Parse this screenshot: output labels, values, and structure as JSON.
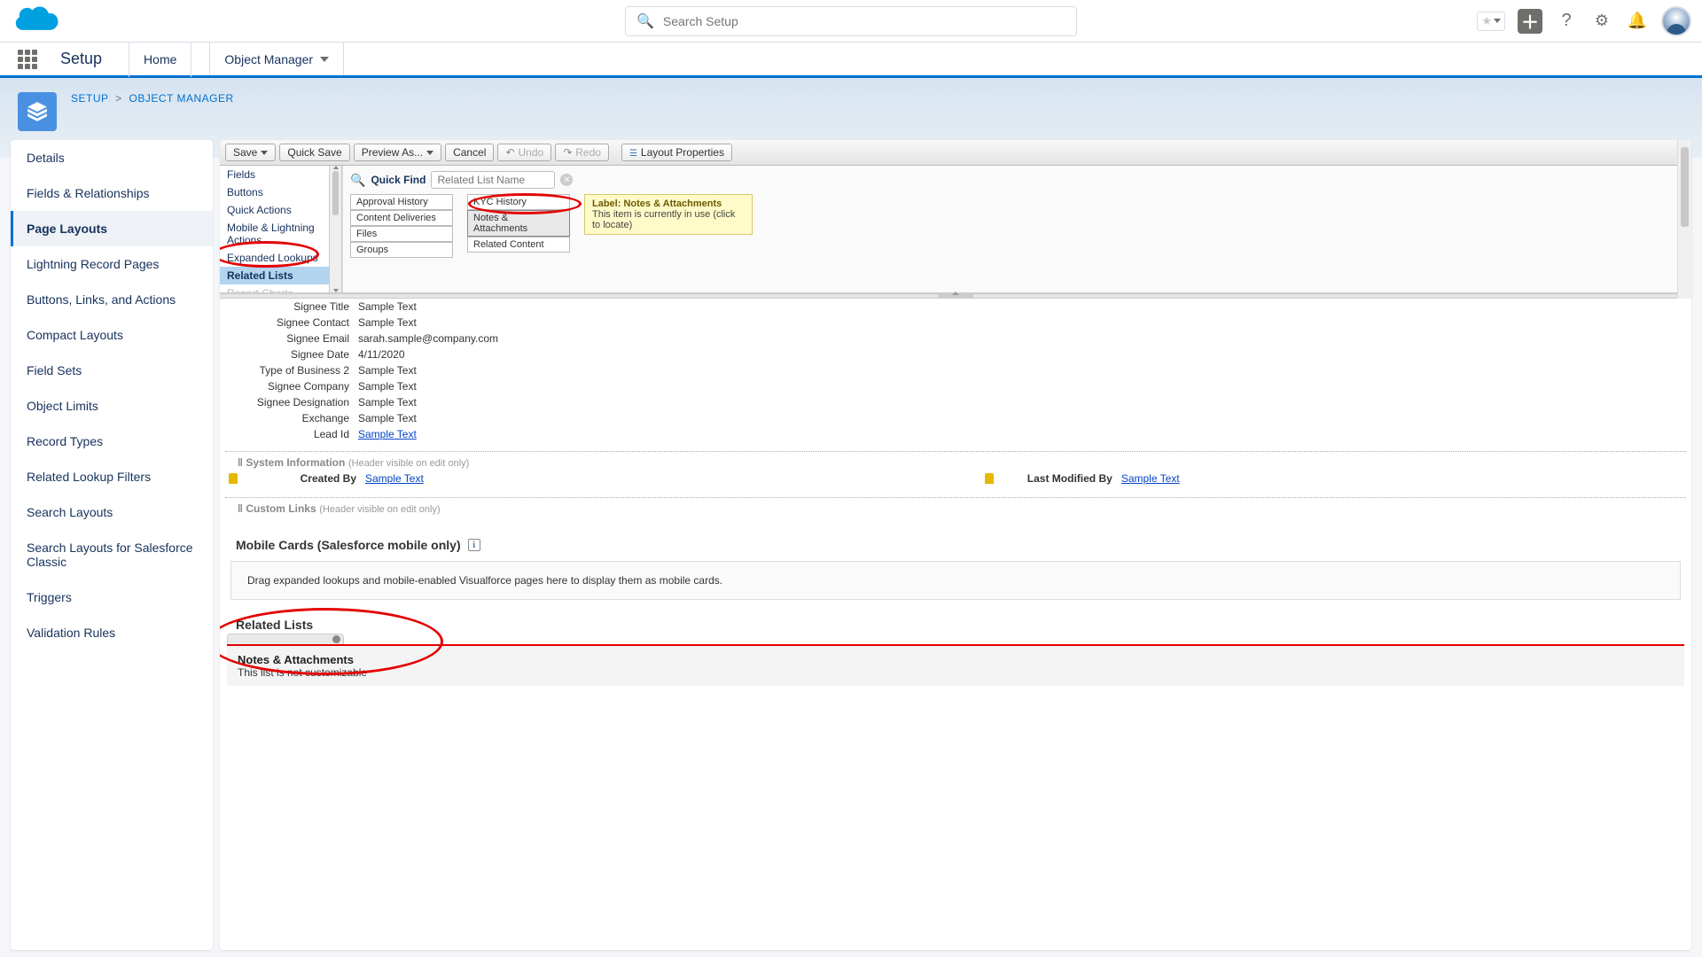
{
  "header": {
    "search_placeholder": "Search Setup"
  },
  "nav": {
    "app_name": "Setup",
    "tabs": {
      "home": "Home",
      "object_manager": "Object Manager"
    }
  },
  "breadcrumb": {
    "setup": "SETUP",
    "object_manager": "OBJECT MANAGER"
  },
  "sidebar": {
    "items": [
      "Details",
      "Fields & Relationships",
      "Page Layouts",
      "Lightning Record Pages",
      "Buttons, Links, and Actions",
      "Compact Layouts",
      "Field Sets",
      "Object Limits",
      "Record Types",
      "Related Lookup Filters",
      "Search Layouts",
      "Search Layouts for Salesforce Classic",
      "Triggers",
      "Validation Rules"
    ],
    "active_index": 2
  },
  "toolbar": {
    "save": "Save",
    "quick_save": "Quick Save",
    "preview_as": "Preview As...",
    "cancel": "Cancel",
    "undo": "Undo",
    "redo": "Redo",
    "layout_props": "Layout Properties"
  },
  "palette": {
    "categories": [
      "Fields",
      "Buttons",
      "Quick Actions",
      "Mobile & Lightning Actions",
      "Expanded Lookups",
      "Related Lists",
      "Report Charts"
    ],
    "selected_index": 5,
    "quick_find_label": "Quick Find",
    "quick_find_placeholder": "Related List Name",
    "col1": [
      "Approval History",
      "Content Deliveries",
      "Files",
      "Groups"
    ],
    "col2": [
      "KYC History",
      "Notes & Attachments",
      "Related Content"
    ],
    "tooltip": {
      "label": "Label: Notes & Attachments",
      "body": "This item is currently in use (click to locate)"
    }
  },
  "fields": [
    {
      "label": "Signee Title",
      "value": "Sample Text"
    },
    {
      "label": "Signee Contact",
      "value": "Sample Text"
    },
    {
      "label": "Signee Email",
      "value": "sarah.sample@company.com"
    },
    {
      "label": "Signee Date",
      "value": "4/11/2020"
    },
    {
      "label": "Type of Business 2",
      "value": "Sample Text"
    },
    {
      "label": "Signee Company",
      "value": "Sample Text"
    },
    {
      "label": "Signee Designation",
      "value": "Sample Text"
    },
    {
      "label": "Exchange",
      "value": "Sample Text"
    },
    {
      "label": "Lead Id",
      "value": "Sample Text",
      "link": true
    }
  ],
  "sections": {
    "system_info": "System Information",
    "custom_links": "Custom Links",
    "header_note": "(Header visible on edit only)",
    "created_by": "Created By",
    "last_modified_by": "Last Modified By",
    "sample_link": "Sample Text"
  },
  "mobile_cards": {
    "heading": "Mobile Cards (Salesforce mobile only)",
    "drop_text": "Drag expanded lookups and mobile-enabled Visualforce pages here to display them as mobile cards."
  },
  "related_lists": {
    "heading": "Related Lists",
    "band_title": "Notes & Attachments",
    "band_sub": "This list is not customizable"
  }
}
